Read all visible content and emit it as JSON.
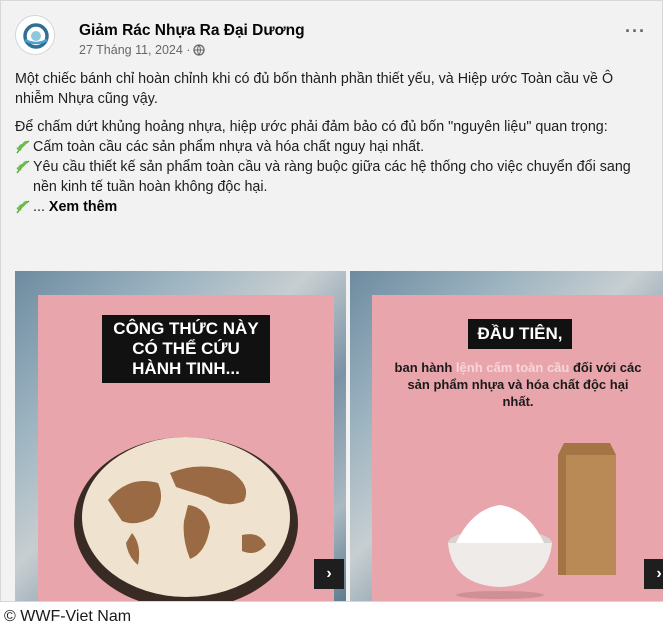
{
  "post": {
    "page_name": "Giảm Rác Nhựa Ra Đại Dương",
    "date": "27 Tháng 11, 2024 ·",
    "privacy_icon": "globe-icon",
    "more_icon": "more-options-icon",
    "paragraph1": "Một chiếc bánh chỉ hoàn chỉnh khi có đủ bốn thành phần thiết yếu, và Hiệp ước Toàn cầu về Ô nhiễm Nhựa cũng vậy.",
    "paragraph2": "Để chấm dứt khủng hoảng nhựa, hiệp ước phải đảm bảo có đủ bốn \"nguyên liệu\" quan trọng:",
    "bullet1": "Cấm toàn cầu các sản phẩm nhựa và hóa chất nguy hại nhất.",
    "bullet2": "Yêu cầu thiết kế sản phẩm toàn cầu và ràng buộc giữa các hệ thống cho việc chuyển đổi sang nền kinh tế tuần hoàn không độc hại.",
    "bullet3_prefix": "...",
    "see_more": "Xem thêm"
  },
  "slides": [
    {
      "headline": "CÔNG THỨC NÀY CÓ THỂ CỨU HÀNH TINH...",
      "next_label": "›"
    },
    {
      "headline": "ĐẦU TIÊN,",
      "sub_before": "ban hành ",
      "sub_highlight": "lệnh cấm toàn cầu",
      "sub_after": " đối với các sản phẩm nhựa và hóa chất độc hại nhất.",
      "next_label": "›"
    }
  ],
  "caption": "© WWF-Viet Nam",
  "colors": {
    "pink_background": "#e8a6ac",
    "headline_bg": "#111111",
    "leaf_green": "#6dbf4b"
  }
}
